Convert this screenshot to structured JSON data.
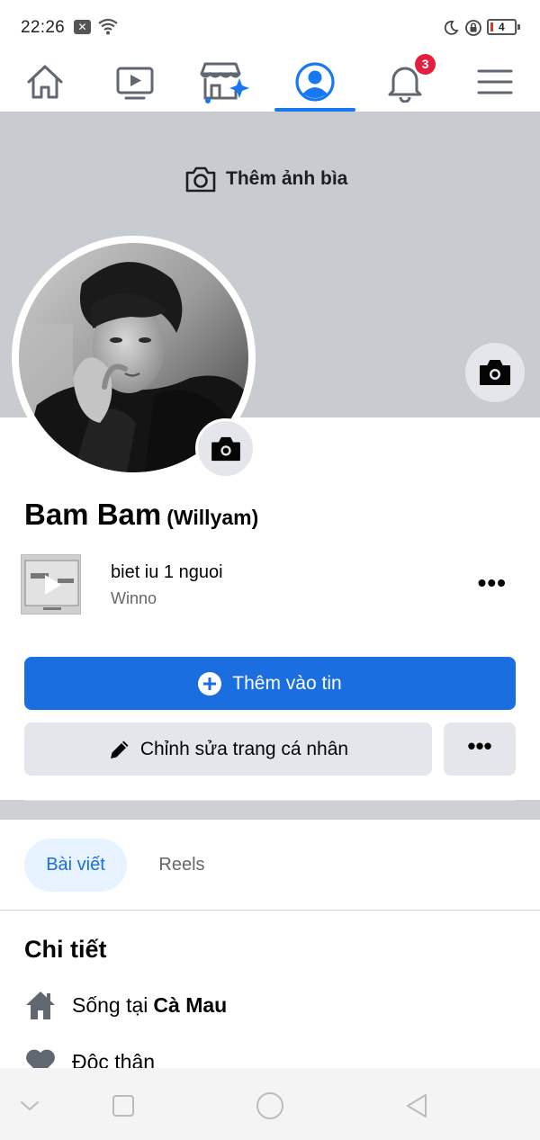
{
  "status_bar": {
    "time": "22:26",
    "battery_level": "4"
  },
  "nav": {
    "items": [
      "home",
      "watch",
      "marketplace",
      "profile",
      "notifications",
      "menu"
    ],
    "active": "profile",
    "notification_count": "3",
    "accent_color": "#1877f2"
  },
  "cover": {
    "add_cover_label": "Thêm ảnh bìa"
  },
  "profile": {
    "name": "Bam Bam",
    "alternate_name": "(Willyam)"
  },
  "music": {
    "title": "biet iu 1 nguoi",
    "artist": "Winno"
  },
  "actions": {
    "add_to_story_label": "Thêm vào tin",
    "edit_profile_label": "Chỉnh sửa trang cá nhân",
    "more_label": "•••"
  },
  "tabs": {
    "posts_label": "Bài viết",
    "reels_label": "Reels"
  },
  "details": {
    "title": "Chi tiết",
    "lives_in_prefix": "Sống tại",
    "lives_in_city": "Cà Mau",
    "relationship": "Độc thân"
  }
}
